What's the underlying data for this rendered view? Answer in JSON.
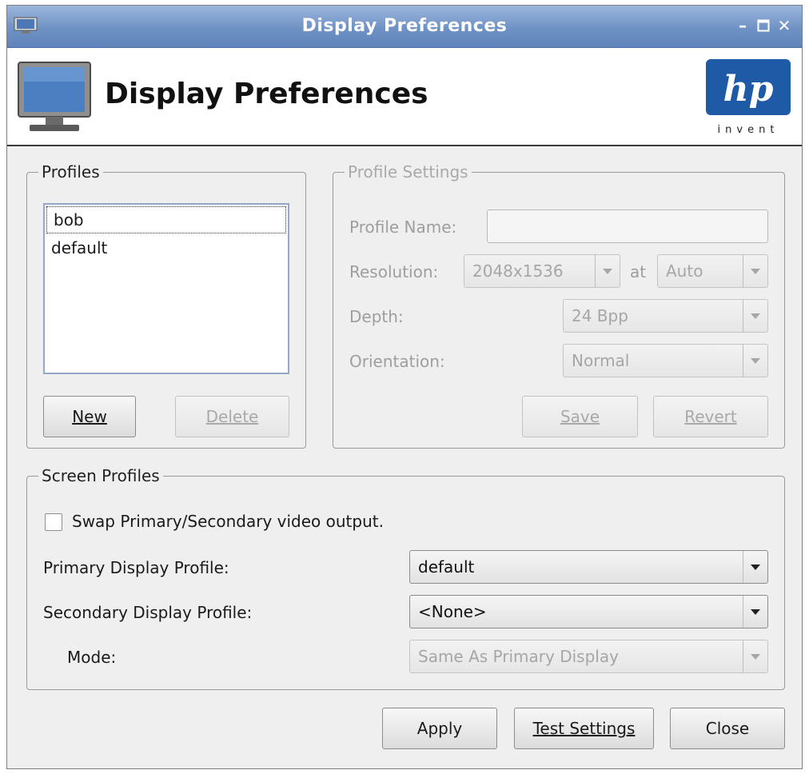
{
  "window": {
    "title": "Display Preferences"
  },
  "header": {
    "title": "Display Preferences",
    "logo_text": "invent"
  },
  "profiles": {
    "legend": "Profiles",
    "items": [
      {
        "label": "bob",
        "selected": true
      },
      {
        "label": "default",
        "selected": false
      }
    ],
    "new_label": "New",
    "delete_label": "Delete"
  },
  "profile_settings": {
    "legend": "Profile Settings",
    "name_label": "Profile Name:",
    "name_value": "",
    "resolution_label": "Resolution:",
    "resolution_value": "2048x1536",
    "at_label": "at",
    "refresh_value": "Auto",
    "depth_label": "Depth:",
    "depth_value": "24 Bpp",
    "orientation_label": "Orientation:",
    "orientation_value": "Normal",
    "save_label": "Save",
    "revert_label": "Revert"
  },
  "screen_profiles": {
    "legend": "Screen Profiles",
    "swap_label": "Swap Primary/Secondary video output.",
    "swap_checked": false,
    "primary_label": "Primary Display Profile:",
    "primary_value": "default",
    "secondary_label": "Secondary Display Profile:",
    "secondary_value": "<None>",
    "mode_label": "Mode:",
    "mode_value": "Same As Primary Display"
  },
  "footer": {
    "apply_label": "Apply",
    "test_label": "Test Settings",
    "close_label": "Close"
  },
  "colors": {
    "titlebar": "#6f92c5",
    "hp_blue": "#1f5aa6"
  }
}
